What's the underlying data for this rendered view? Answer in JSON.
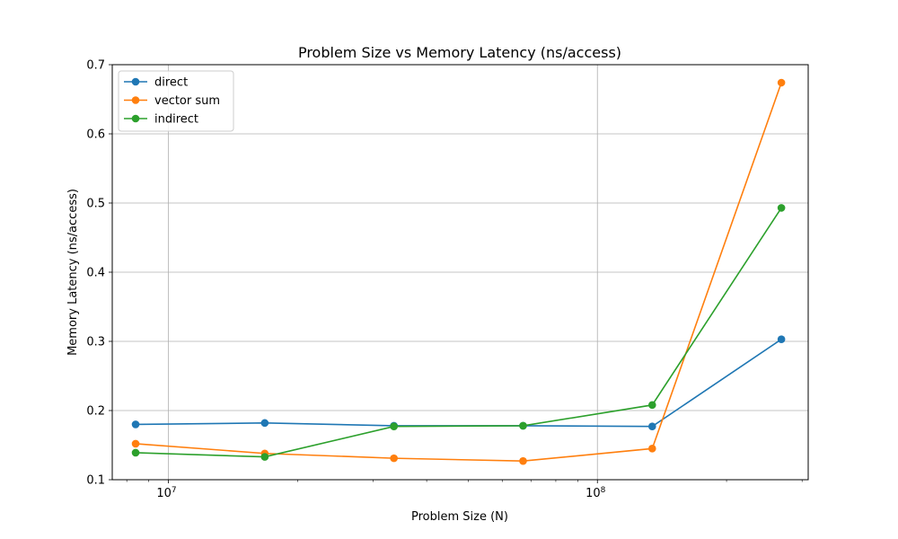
{
  "chart_data": {
    "type": "line",
    "title": "Problem Size vs Memory Latency (ns/access)",
    "xlabel": "Problem Size (N)",
    "ylabel": "Memory Latency (ns/access)",
    "xscale": "log",
    "xlim": [
      7400000,
      310000000
    ],
    "ylim": [
      0.1,
      0.7
    ],
    "yticks": [
      0.1,
      0.2,
      0.3,
      0.4,
      0.5,
      0.6,
      0.7
    ],
    "ytick_labels": [
      "0.1",
      "0.2",
      "0.3",
      "0.4",
      "0.5",
      "0.6",
      "0.7"
    ],
    "xticks_major": [
      10000000,
      100000000
    ],
    "xtick_labels": [
      "10^7",
      "10^8"
    ],
    "grid": true,
    "legend_position": "top-left",
    "x": [
      8388608,
      16777216,
      33554432,
      67108864,
      134217728,
      268435456
    ],
    "series": [
      {
        "name": "direct",
        "color": "#1f77b4",
        "values": [
          0.18,
          0.182,
          0.178,
          0.178,
          0.177,
          0.303
        ]
      },
      {
        "name": "vector sum",
        "color": "#ff7f0e",
        "values": [
          0.152,
          0.138,
          0.131,
          0.127,
          0.145,
          0.674
        ]
      },
      {
        "name": "indirect",
        "color": "#2ca02c",
        "values": [
          0.139,
          0.133,
          0.177,
          0.178,
          0.208,
          0.493
        ]
      }
    ]
  }
}
